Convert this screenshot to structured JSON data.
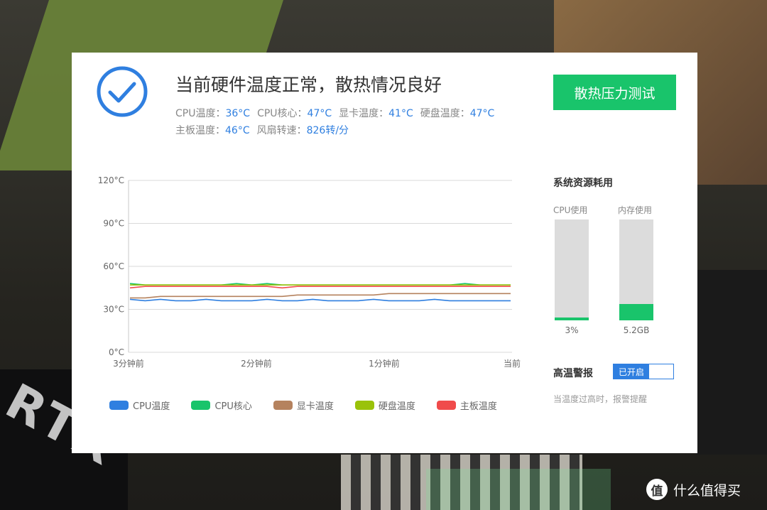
{
  "header": {
    "headline": "当前硬件温度正常，散热情况良好",
    "stress_test_label": "散热压力测试"
  },
  "temps": [
    {
      "label": "CPU温度：",
      "value": "36°C"
    },
    {
      "label": "CPU核心：",
      "value": "47°C"
    },
    {
      "label": "显卡温度：",
      "value": "41°C"
    },
    {
      "label": "硬盘温度：",
      "value": "47°C"
    },
    {
      "label": "主板温度：",
      "value": "46°C"
    },
    {
      "label": "风扇转速：",
      "value": "826转/分"
    }
  ],
  "colors": {
    "accent_green": "#19c46b",
    "accent_blue": "#2f7fe0"
  },
  "chart_data": {
    "type": "line",
    "x": [
      "3分钟前",
      "2分钟前",
      "1分钟前",
      "当前"
    ],
    "yticks": [
      "0°C",
      "30°C",
      "60°C",
      "90°C",
      "120°C"
    ],
    "ylim": [
      0,
      120
    ],
    "grid": true,
    "legend_placement": "bottom",
    "series": [
      {
        "name": "CPU温度",
        "color": "#2f7fe0",
        "values": [
          37,
          36,
          37,
          36,
          36,
          37,
          36,
          36,
          36,
          37,
          36,
          36,
          37,
          36,
          36,
          36,
          37,
          36,
          36,
          36,
          37,
          36,
          36,
          36,
          36,
          36
        ]
      },
      {
        "name": "CPU核心",
        "color": "#19c46b",
        "values": [
          48,
          47,
          47,
          47,
          47,
          47,
          47,
          48,
          47,
          48,
          47,
          47,
          47,
          47,
          47,
          47,
          47,
          47,
          47,
          47,
          47,
          47,
          48,
          47,
          47,
          47
        ]
      },
      {
        "name": "显卡温度",
        "color": "#b5825e",
        "values": [
          38,
          38,
          39,
          39,
          39,
          39,
          39,
          39,
          39,
          39,
          39,
          40,
          40,
          40,
          40,
          40,
          40,
          41,
          41,
          41,
          41,
          41,
          41,
          41,
          41,
          41
        ]
      },
      {
        "name": "硬盘温度",
        "color": "#9ac20a",
        "values": [
          47,
          47,
          47,
          47,
          47,
          47,
          47,
          47,
          47,
          47,
          47,
          47,
          47,
          47,
          47,
          47,
          47,
          47,
          47,
          47,
          47,
          47,
          47,
          47,
          47,
          47
        ]
      },
      {
        "name": "主板温度",
        "color": "#f04b4b",
        "values": [
          45,
          46,
          46,
          46,
          46,
          46,
          46,
          46,
          46,
          46,
          45,
          46,
          46,
          46,
          46,
          46,
          46,
          46,
          46,
          46,
          46,
          46,
          46,
          46,
          46,
          46
        ]
      }
    ]
  },
  "resources": {
    "title": "系统资源耗用",
    "cpu": {
      "label": "CPU使用",
      "value": "3%",
      "fraction": 0.03
    },
    "memory": {
      "label": "内存使用",
      "value": "5.2GB",
      "fraction": 0.16
    }
  },
  "alarm": {
    "title": "高温警报",
    "toggle_label": "已开启",
    "description": "当温度过高时，报警提醒"
  },
  "watermark": {
    "logo": "值",
    "text": "什么值得买"
  },
  "background": {
    "print": "RTX"
  }
}
